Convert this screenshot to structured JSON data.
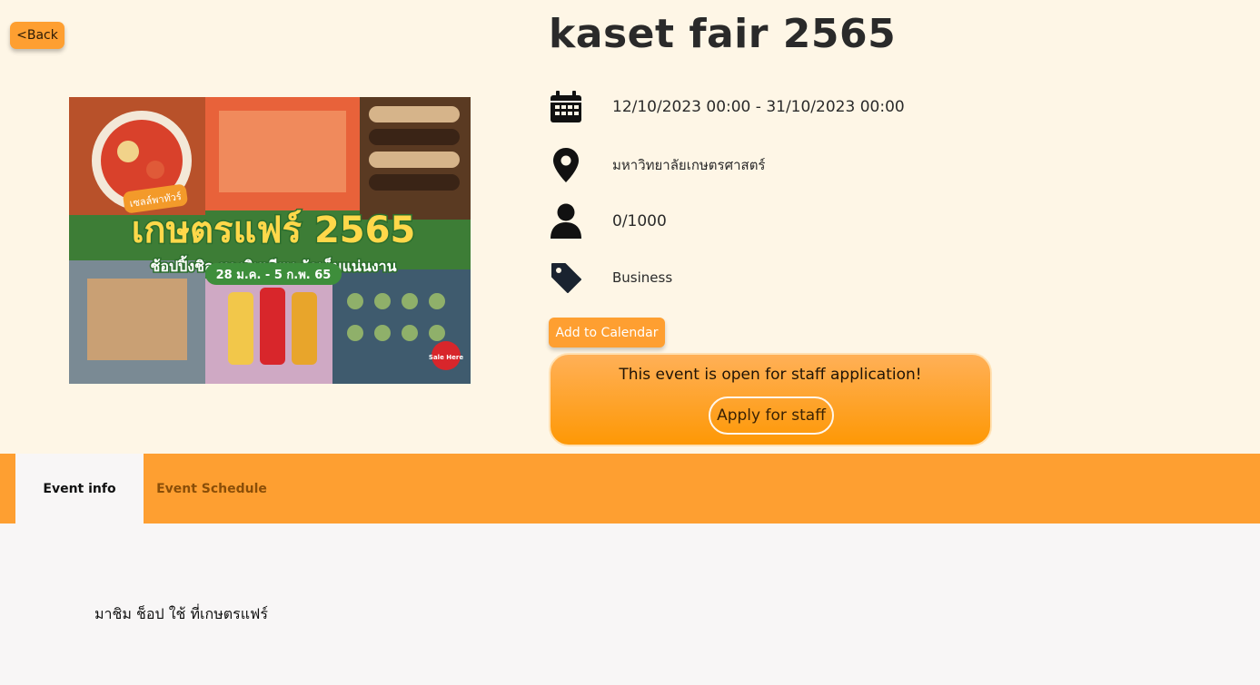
{
  "nav": {
    "back_label": "<Back"
  },
  "event": {
    "title": "kaset fair 2565",
    "datetime": "12/10/2023 00:00 - 31/10/2023 00:00",
    "location": "มหาวิทยาลัยเกษตรศาสตร์",
    "attendance": "0/1000",
    "category": "Business",
    "description": "มาชิม ช็อป ใช้ ที่เกษตรแฟร์"
  },
  "poster": {
    "badge": "เซลล์พาทัวร์",
    "headline": "เกษตรแฟร์ 2565",
    "tagline": "ช้อปปิ้งชิล ของกินเพียบ จัดเต็มแน่นงาน",
    "dates": "28 ม.ค. - 5 ก.พ. 65",
    "sale_stamp": "Sale Here"
  },
  "actions": {
    "add_calendar_label": "Add to Calendar",
    "staff_message": "This event is open for staff application!",
    "apply_staff_label": "Apply for staff"
  },
  "tabs": [
    {
      "label": "Event info",
      "active": true
    },
    {
      "label": "Event Schedule",
      "active": false
    }
  ],
  "icons": {
    "calendar": "calendar-icon",
    "location": "map-pin-icon",
    "person": "person-icon",
    "tag": "tag-icon"
  },
  "colors": {
    "accent": "#fe9f31",
    "page_bg": "#fef6e6",
    "content_bg": "#f8f6f6"
  }
}
